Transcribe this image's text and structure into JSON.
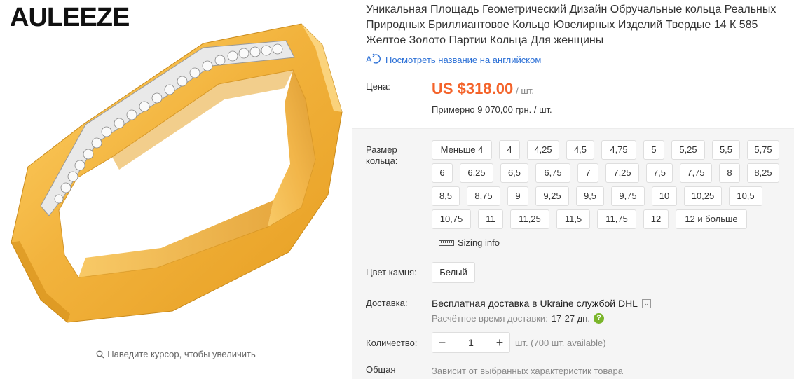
{
  "brand": {
    "logo_text": "AULEEZE"
  },
  "gallery": {
    "zoom_hint": "Наведите курсор, чтобы увеличить"
  },
  "product": {
    "title": "Уникальная Площадь Геометрический Дизайн Обручальные кольца Реальных Природных Бриллиантовое Кольцо Ювелирных Изделий Твердые 14 К 585 Желтое Золото Партии Кольца Для женщины",
    "translate_link": "Посмотреть название на английском"
  },
  "price": {
    "label": "Цена:",
    "value": "US $318.00",
    "unit": "/ шт.",
    "approx": "Примерно 9 070,00 грн. / шт."
  },
  "ring_size": {
    "label": "Размер кольца:",
    "options": [
      "Меньше 4",
      "4",
      "4,25",
      "4,5",
      "4,75",
      "5",
      "5,25",
      "5,5",
      "5,75",
      "6",
      "6,25",
      "6,5",
      "6,75",
      "7",
      "7,25",
      "7,5",
      "7,75",
      "8",
      "8,25",
      "8,5",
      "8,75",
      "9",
      "9,25",
      "9,5",
      "9,75",
      "10",
      "10,25",
      "10,5",
      "10,75",
      "11",
      "11,25",
      "11,5",
      "11,75",
      "12",
      "12 и больше"
    ],
    "sizing_info": "Sizing info"
  },
  "stone_color": {
    "label": "Цвет камня:",
    "options": [
      "Белый"
    ]
  },
  "delivery": {
    "label": "Доставка:",
    "text": "Бесплатная доставка в Ukraine службой DHL",
    "eta_label": "Расчётное время доставки:",
    "eta_value": "17-27 дн."
  },
  "quantity": {
    "label": "Количество:",
    "value": "1",
    "minus": "−",
    "plus": "+",
    "note": "шт. (700 шт. available)"
  },
  "total": {
    "label": "Общая стоимость:",
    "text": "Зависит от выбранных характеристик товара"
  },
  "colors": {
    "price": "#f4632a",
    "link": "#2a6fd6",
    "gold": "#f2b33d",
    "help": "#7ab52a"
  },
  "icons": [
    "search-icon",
    "translate-icon",
    "ruler-icon",
    "chevron-down-icon",
    "help-icon"
  ]
}
